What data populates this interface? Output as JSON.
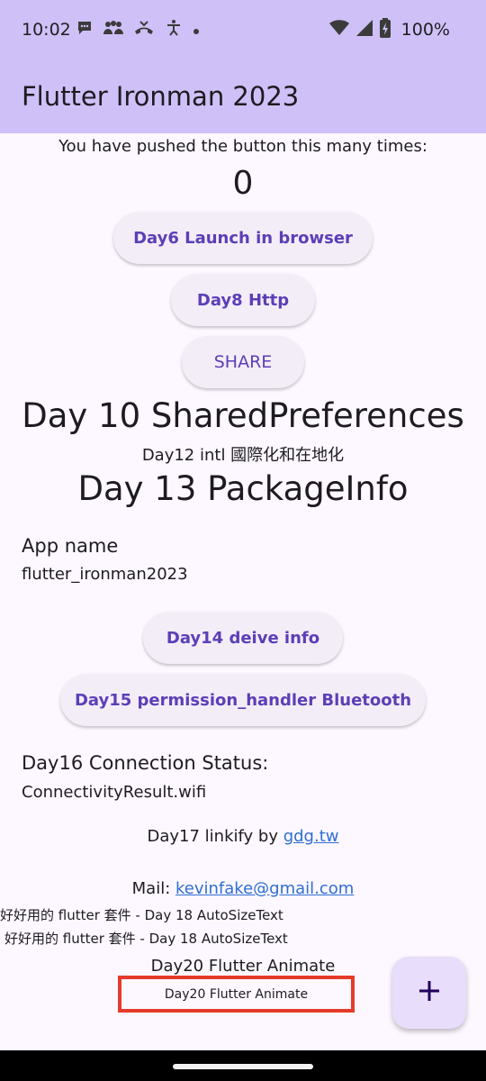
{
  "status_bar": {
    "time": "10:02",
    "battery": "100%",
    "icons": [
      "chat-icon",
      "group-icon",
      "missed-call-icon",
      "accessibility-icon",
      "dot-icon"
    ],
    "right_icons": [
      "wifi-icon",
      "signal-icon",
      "battery-icon"
    ]
  },
  "app_bar": {
    "title": "Flutter Ironman 2023",
    "color": "#cfc0f7"
  },
  "counter": {
    "label": "You have pushed the button this many times:",
    "value": "0"
  },
  "buttons": {
    "day6": "Day6 Launch in browser",
    "day8": "Day8 Http",
    "share": "SHARE",
    "day14": "Day14 deive info",
    "day15": "Day15 permission_handler Bluetooth"
  },
  "headings": {
    "day10": "Day 10 SharedPreferences",
    "day12": "Day12 intl 國際化和在地化",
    "day13": "Day 13 PackageInfo"
  },
  "package_info": {
    "label": "App name",
    "value": "flutter_ironman2023"
  },
  "connection": {
    "label": "Day16 Connection Status:",
    "value": "ConnectivityResult.wifi"
  },
  "linkify": {
    "prefix": "Day17 linkify by ",
    "link": "gdg.tw",
    "mail_prefix": "Mail: ",
    "mail_link": "kevinfake@gmail.com"
  },
  "autosize": {
    "line1": "好好用的 flutter 套件 - Day 18 AutoSizeText",
    "line2": "好好用的 flutter 套件 - Day 18 AutoSizeText"
  },
  "animate": {
    "label": "Day20 Flutter Animate",
    "boxed": "Day20 Flutter Animate"
  },
  "fab": {
    "icon": "plus-icon"
  },
  "colors": {
    "accent": "#5b3fb7",
    "highlight": "#e53b2a",
    "link": "#2e6fd1"
  }
}
